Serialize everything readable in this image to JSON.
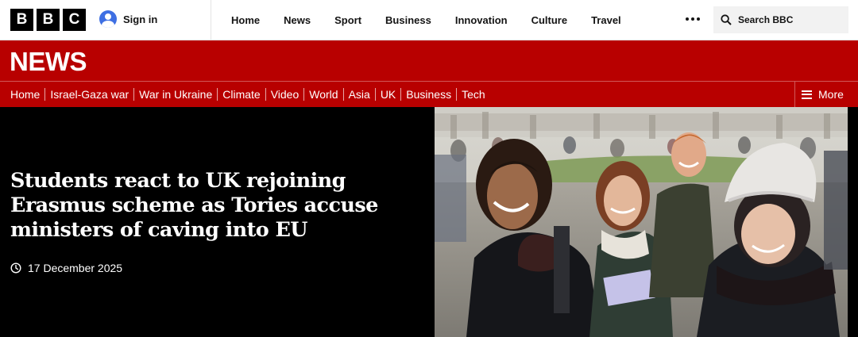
{
  "logo": {
    "letters": [
      "B",
      "B",
      "C"
    ]
  },
  "header": {
    "sign_in": "Sign in",
    "nav": [
      "Home",
      "News",
      "Sport",
      "Business",
      "Innovation",
      "Culture",
      "Travel"
    ],
    "more_icon": "more-dots-icon",
    "search_label": "Search BBC"
  },
  "section": {
    "title": "NEWS",
    "subnav": [
      "Home",
      "Israel-Gaza war",
      "War in Ukraine",
      "Climate",
      "Video",
      "World",
      "Asia",
      "UK",
      "Business",
      "Tech"
    ],
    "more_label": "More"
  },
  "hero": {
    "headline": "Students react to UK rejoining Erasmus scheme as Tories accuse ministers of caving into EU",
    "date": "17 December 2025",
    "image_alt": "photo-of-students-walking"
  },
  "colors": {
    "brand_red": "#b80000",
    "avatar_blue": "#3e6fe3"
  }
}
